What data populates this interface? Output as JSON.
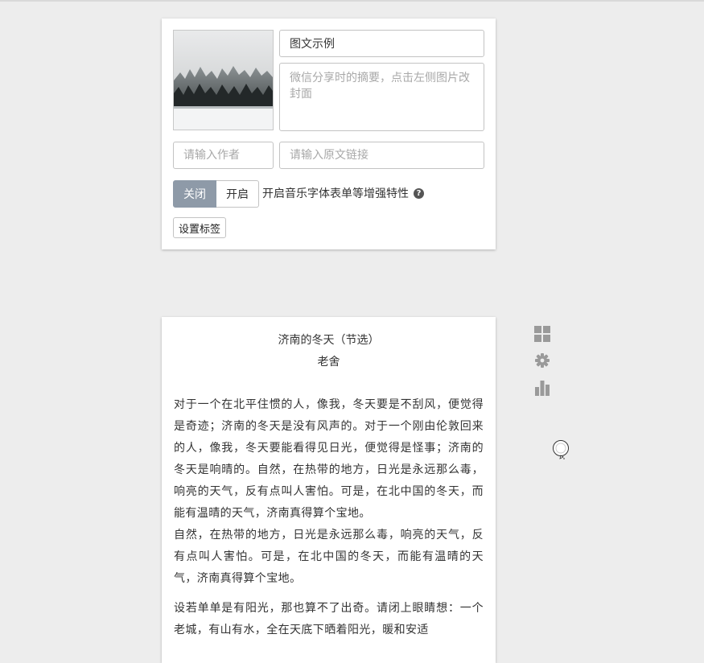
{
  "editor": {
    "title_value": "图文示例",
    "summary_placeholder": "微信分享时的摘要，点击左侧图片改封面",
    "author_placeholder": "请输入作者",
    "link_placeholder": "请输入原文链接",
    "toggle_off_label": "关闭",
    "toggle_on_label": "开启",
    "toggle_selected": "关闭",
    "feature_label": "开启音乐字体表单等增强特性",
    "tag_button_label": "设置标签"
  },
  "article": {
    "title": "济南的冬天（节选）",
    "author": "老舍",
    "paragraphs": [
      "对于一个在北平住惯的人，像我，冬天要是不刮风，便觉得是奇迹；济南的冬天是没有风声的。对于一个刚由伦敦回来的人，像我，冬天要能看得见日光，便觉得是怪事；济南的冬天是响晴的。自然，在热带的地方，日光是永远那么毒，响亮的天气，反有点叫人害怕。可是，在北中国的冬天，而能有温晴的天气，济南真得算个宝地。",
      "自然，在热带的地方，日光是永远那么毒，响亮的天气，反有点叫人害怕。可是，在北中国的冬天，而能有温晴的天气，济南真得算个宝地。",
      "设若单单是有阳光，那也算不了出奇。请闭上眼睛想：一个老城，有山有水，全在天底下晒着阳光，暖和安适"
    ]
  },
  "icons": {
    "cover": "snowy-forest-cover-image",
    "help": "question-circle-icon",
    "side": [
      "grid-icon",
      "gear-icon",
      "bar-chart-icon"
    ],
    "cursor": "busy-cursor"
  },
  "colors": {
    "page_bg": "#ededed",
    "toggle_active_bg": "#8e9aa8",
    "side_icon": "#9a9a9a"
  }
}
